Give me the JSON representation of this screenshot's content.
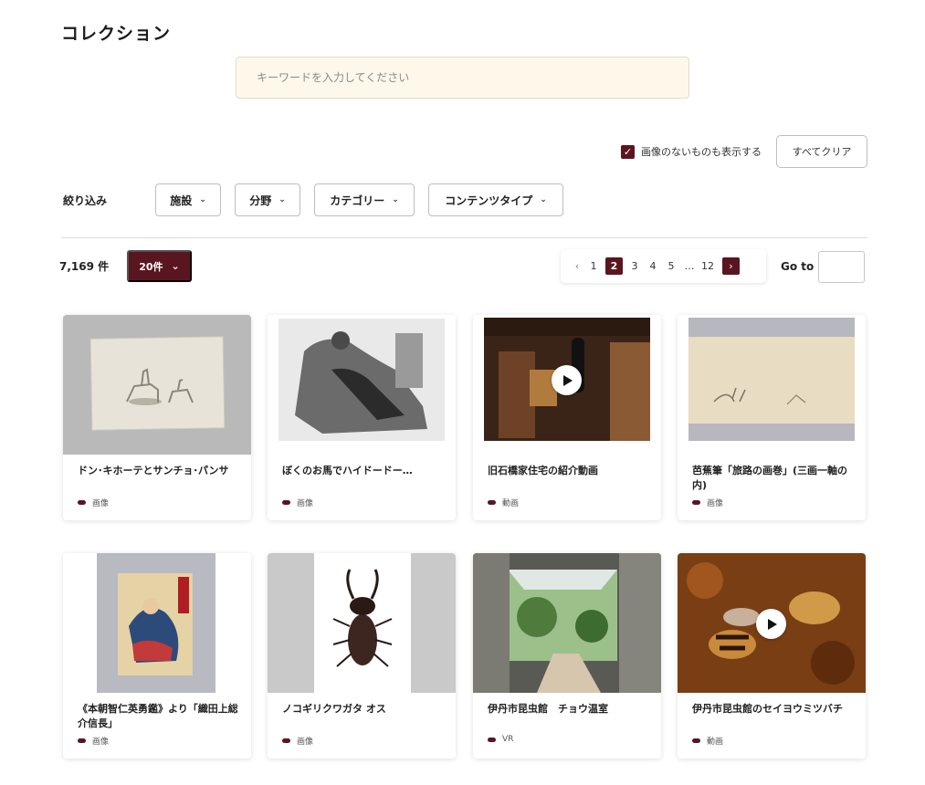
{
  "page": {
    "title": "コレクション"
  },
  "search": {
    "placeholder": "キーワードを入力してください"
  },
  "options": {
    "show_no_image_label": "画像のないものも表示する",
    "checkmark": "✓",
    "clear_all_label": "すべてクリア"
  },
  "filters": {
    "label": "絞り込み",
    "items": [
      {
        "label": "施設"
      },
      {
        "label": "分野"
      },
      {
        "label": "カテゴリー"
      },
      {
        "label": "コンテンツタイプ"
      }
    ],
    "chevron": "⌄"
  },
  "results": {
    "count": "7,169 件",
    "per_page_label": "20件",
    "per_page_chevron": "⌄"
  },
  "pagination": {
    "prev": "‹",
    "pages": [
      "1",
      "2",
      "3",
      "4",
      "5",
      "…",
      "12"
    ],
    "current": "2",
    "next": "›",
    "goto_label": "Go to",
    "goto_value": ""
  },
  "cards": [
    {
      "title": "ドン･キホーテとサンチョ･パンサ",
      "type": "画像",
      "thumb_icon": "sketch-image",
      "has_play": false
    },
    {
      "title": "ぼくのお馬でハイドードー…",
      "type": "画像",
      "thumb_icon": "lithograph-image",
      "has_play": false
    },
    {
      "title": "旧石橋家住宅の紹介動画",
      "type": "動画",
      "thumb_icon": "house-video",
      "has_play": true
    },
    {
      "title": "芭蕉筆「旅路の画巻」(三画一軸の内)",
      "type": "画像",
      "thumb_icon": "scroll-painting-image",
      "has_play": false
    },
    {
      "title": "《本朝智仁英勇鑑》より「織田上総介信長」",
      "type": "画像",
      "thumb_icon": "ukiyoe-image",
      "has_play": false
    },
    {
      "title": "ノコギリクワガタ オス",
      "type": "画像",
      "thumb_icon": "stag-beetle-image",
      "has_play": false
    },
    {
      "title": "伊丹市昆虫館　チョウ温室",
      "type": "VR",
      "thumb_icon": "greenhouse-image",
      "has_play": false
    },
    {
      "title": "伊丹市昆虫館のセイヨウミツバチ",
      "type": "動画",
      "thumb_icon": "honeybee-video",
      "has_play": true
    }
  ],
  "colors": {
    "accent": "#5a1620",
    "search_bg": "#fdf8ea"
  }
}
